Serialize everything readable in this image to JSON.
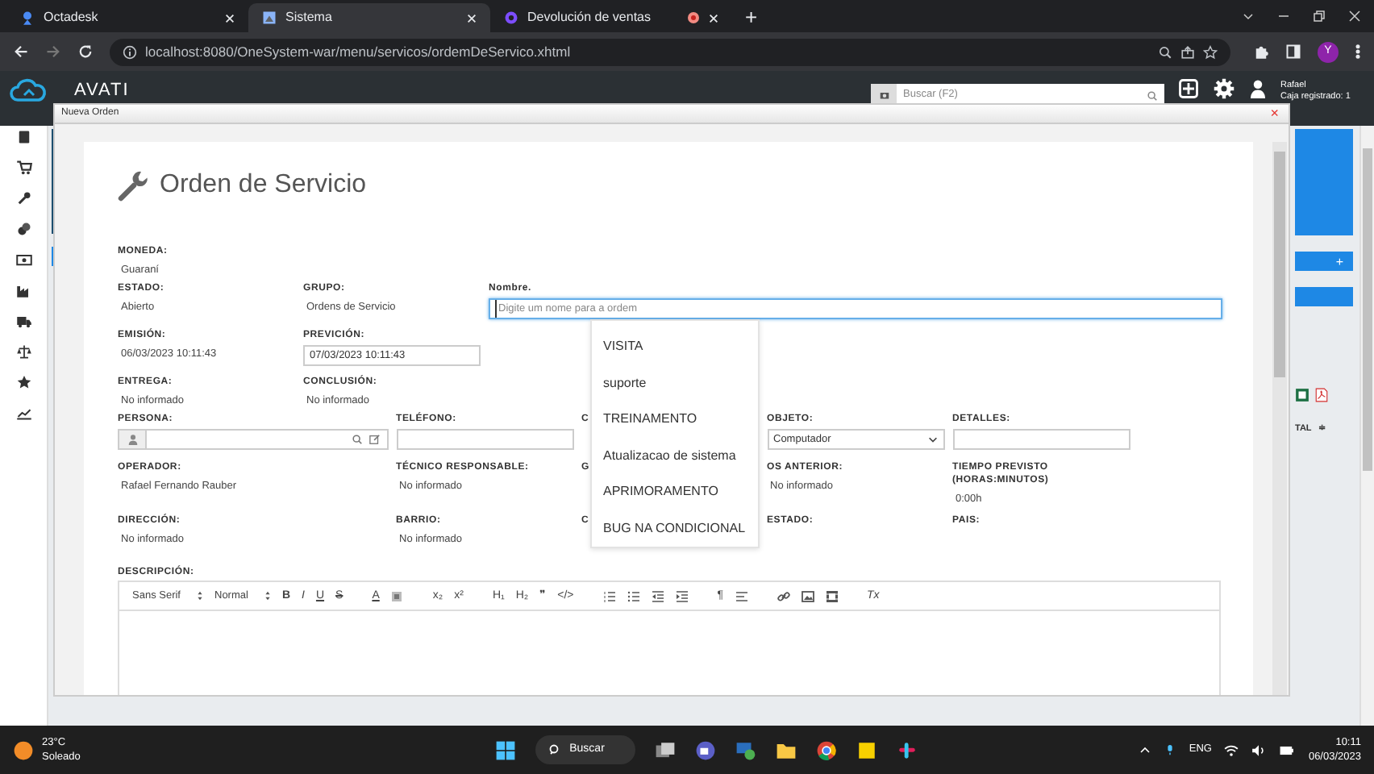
{
  "browser": {
    "tabs": [
      {
        "title": "Octadesk",
        "selected": false
      },
      {
        "title": "Sistema",
        "selected": true
      },
      {
        "title": "Devolución de ventas",
        "selected": false
      }
    ],
    "new_tab": "+",
    "url": "localhost:8080/OneSystem-war/menu/servicos/ordemDeServico.xhtml",
    "profile_initial": "Y"
  },
  "app_header": {
    "logo": "AVATI",
    "search_placeholder": "Buscar (F2)",
    "user_name": "Rafael",
    "user_detail": "Caja registrado: 1"
  },
  "background": {
    "add_button": "+",
    "column_fragment": "TAL",
    "sort_glyph": "≑"
  },
  "modal": {
    "title": "Nueva Orden",
    "close": "×",
    "heading": "Orden de Servicio",
    "rows": [
      [
        {
          "label": "MONEDA:",
          "kind": "text",
          "value": "Guaraní"
        }
      ],
      [
        {
          "label": "ESTADO:",
          "kind": "text",
          "value": "Abierto"
        },
        {
          "label": "GRUPO:",
          "kind": "text",
          "value": "Ordens de Servicio"
        },
        {
          "label": "Nombre.",
          "kind": "input",
          "placeholder": "Digite um nome para a ordem",
          "focused": true
        }
      ],
      [
        {
          "label": "EMISIÓN:",
          "kind": "text",
          "value": "06/03/2023 10:11:43"
        },
        {
          "label": "PREVICIÓN:",
          "kind": "input",
          "value": "07/03/2023 10:11:43",
          "focused": false
        }
      ],
      [
        {
          "label": "ENTREGA:",
          "kind": "text",
          "value": "No informado"
        },
        {
          "label": "CONCLUSIÓN:",
          "kind": "text",
          "value": "No informado"
        }
      ],
      [
        {
          "label": "PERSONA:",
          "kind": "lookup"
        },
        {
          "label": "TELÉFONO:",
          "kind": "input",
          "focused": false
        },
        {
          "label": "C",
          "kind": "label"
        },
        {
          "label": "OBJETO:",
          "kind": "select",
          "value": "Computador"
        },
        {
          "label": "DETALLES:",
          "kind": "input",
          "focused": false
        }
      ],
      [
        {
          "label": "OPERADOR:",
          "kind": "text",
          "value": "Rafael Fernando Rauber"
        },
        {
          "label": "TÉCNICO RESPONSABLE:",
          "kind": "text",
          "value": "No informado"
        },
        {
          "label": "G",
          "kind": "label"
        },
        {
          "label": "OS ANTERIOR:",
          "kind": "text",
          "value": "No informado"
        },
        {
          "label": "TIEMPO PREVISTO (HORAS:MINUTOS)",
          "kind": "text",
          "value": "0:00h"
        }
      ],
      [
        {
          "label": "DIRECCIÓN:",
          "kind": "text",
          "value": "No informado"
        },
        {
          "label": "BARRIO:",
          "kind": "text",
          "value": "No informado"
        },
        {
          "label": "C",
          "kind": "label"
        },
        {
          "label": "ESTADO:",
          "kind": "label"
        },
        {
          "label": "PAIS:",
          "kind": "label"
        }
      ]
    ],
    "suggestions": [
      "VISITA",
      "suporte",
      "TREINAMENTO",
      "Atualizacao de sistema",
      "APRIMORAMENTO",
      "BUG NA CONDICIONAL"
    ],
    "description": {
      "label": "DESCRIPCIÓN:",
      "font": "Sans Serif",
      "size": "Normal",
      "glyphs": [
        "B",
        "I",
        "U",
        "S",
        "A",
        "x₂",
        "x²",
        "H₁",
        "H₂",
        "❞",
        "</>",
        "¶",
        "Tx"
      ]
    }
  },
  "taskbar": {
    "temperature": "23°C",
    "weather": "Soleado",
    "search": "Buscar",
    "language": "ENG",
    "time": "10:11",
    "date": "06/03/2023"
  }
}
